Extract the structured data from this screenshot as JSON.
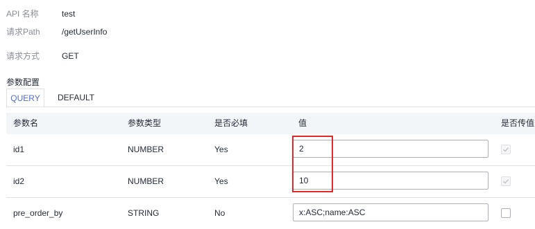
{
  "api_info": {
    "name_label": "API 名称",
    "name_value": "test",
    "path_label": "请求Path",
    "path_value": "/getUserInfo",
    "method_label": "请求方式",
    "method_value": "GET"
  },
  "param_section": {
    "title": "参数配置",
    "tabs": [
      {
        "label": "QUERY",
        "active": true
      },
      {
        "label": "DEFAULT",
        "active": false
      }
    ]
  },
  "table": {
    "headers": [
      "参数名",
      "参数类型",
      "是否必填",
      "值",
      "是否传值"
    ],
    "rows": [
      {
        "name": "id1",
        "type": "NUMBER",
        "required": "Yes",
        "value": "2",
        "pass_value_checked": true,
        "pass_value_disabled": true
      },
      {
        "name": "id2",
        "type": "NUMBER",
        "required": "Yes",
        "value": "10",
        "pass_value_checked": true,
        "pass_value_disabled": true
      },
      {
        "name": "pre_order_by",
        "type": "STRING",
        "required": "No",
        "value": "x:ASC;name:ASC",
        "pass_value_checked": false,
        "pass_value_disabled": false
      }
    ]
  },
  "colors": {
    "active_tab": "#526ecc",
    "highlight_box": "#e02828",
    "header_bg": "#f3f6f8",
    "label_gray": "#8a8e99"
  }
}
